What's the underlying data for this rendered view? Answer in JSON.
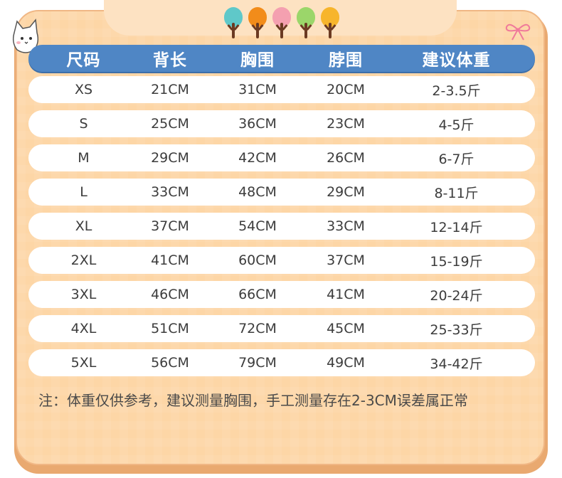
{
  "table": {
    "headers": [
      "尺码",
      "背长",
      "胸围",
      "脖围",
      "建议体重"
    ],
    "rows": [
      [
        "XS",
        "21CM",
        "31CM",
        "20CM",
        "2-3.5斤"
      ],
      [
        "S",
        "25CM",
        "36CM",
        "23CM",
        "4-5斤"
      ],
      [
        "M",
        "29CM",
        "42CM",
        "26CM",
        "6-7斤"
      ],
      [
        "L",
        "33CM",
        "48CM",
        "29CM",
        "8-11斤"
      ],
      [
        "XL",
        "37CM",
        "54CM",
        "33CM",
        "12-14斤"
      ],
      [
        "2XL",
        "41CM",
        "60CM",
        "37CM",
        "15-19斤"
      ],
      [
        "3XL",
        "46CM",
        "66CM",
        "41CM",
        "20-24斤"
      ],
      [
        "4XL",
        "51CM",
        "72CM",
        "45CM",
        "25-33斤"
      ],
      [
        "5XL",
        "56CM",
        "79CM",
        "49CM",
        "34-42斤"
      ]
    ]
  },
  "note": "注：体重仅供参考，建议测量胸围，手工测量存在2-3CM误差属正常",
  "decorations": {
    "tree_colors": [
      "#5fc8c9",
      "#f28c1a",
      "#f4a0b0",
      "#9bd66a",
      "#f7b52c"
    ],
    "icons": [
      "cat-icon",
      "tree-icon",
      "ribbon-bow-icon"
    ]
  },
  "colors": {
    "background": "#fdd6a6",
    "header": "#4f86c5",
    "row": "#ffffff"
  }
}
